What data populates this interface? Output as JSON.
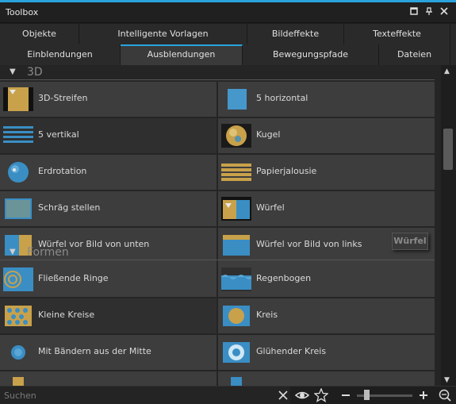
{
  "window": {
    "title": "Toolbox",
    "controls": [
      "maximize-icon",
      "pin-icon",
      "close-icon"
    ]
  },
  "tabs": {
    "row1": [
      {
        "label": "Objekte"
      },
      {
        "label": "Intelligente Vorlagen"
      },
      {
        "label": "Bildeffekte"
      },
      {
        "label": "Texteffekte"
      }
    ],
    "row2": [
      {
        "label": "Einblendungen",
        "active": false
      },
      {
        "label": "Ausblendungen",
        "active": true
      },
      {
        "label": "Bewegungspfade",
        "active": false
      },
      {
        "label": "Dateien",
        "active": false
      }
    ]
  },
  "sections": {
    "s3d": {
      "label": "3D"
    },
    "formen": {
      "label": "Formen"
    }
  },
  "items": {
    "d3_streifen": "3D-Streifen",
    "horizontal5": "5 horizontal",
    "vertikal5": "5 vertikal",
    "kugel": "Kugel",
    "erdrotation": "Erdrotation",
    "papierjalousie": "Papierjalousie",
    "schraeg": "Schräg stellen",
    "wuerfel": "Würfel",
    "wuerfel_unten": "Würfel vor Bild von unten",
    "wuerfel_links": "Würfel vor Bild von links",
    "ringe": "Fließende Ringe",
    "regenbogen": "Regenbogen",
    "kleine_kreise": "Kleine Kreise",
    "kreis": "Kreis",
    "baendern": "Mit Bändern aus der Mitte",
    "gluehender": "Glühender Kreis"
  },
  "tooltip": "Würfel",
  "search": {
    "placeholder": "Suchen",
    "value": ""
  },
  "zoom": {
    "level": 0.15
  },
  "colors": {
    "accent": "#2aa3dc",
    "thumb_blue": "#3a8ec4",
    "thumb_gold": "#c8a14a"
  }
}
